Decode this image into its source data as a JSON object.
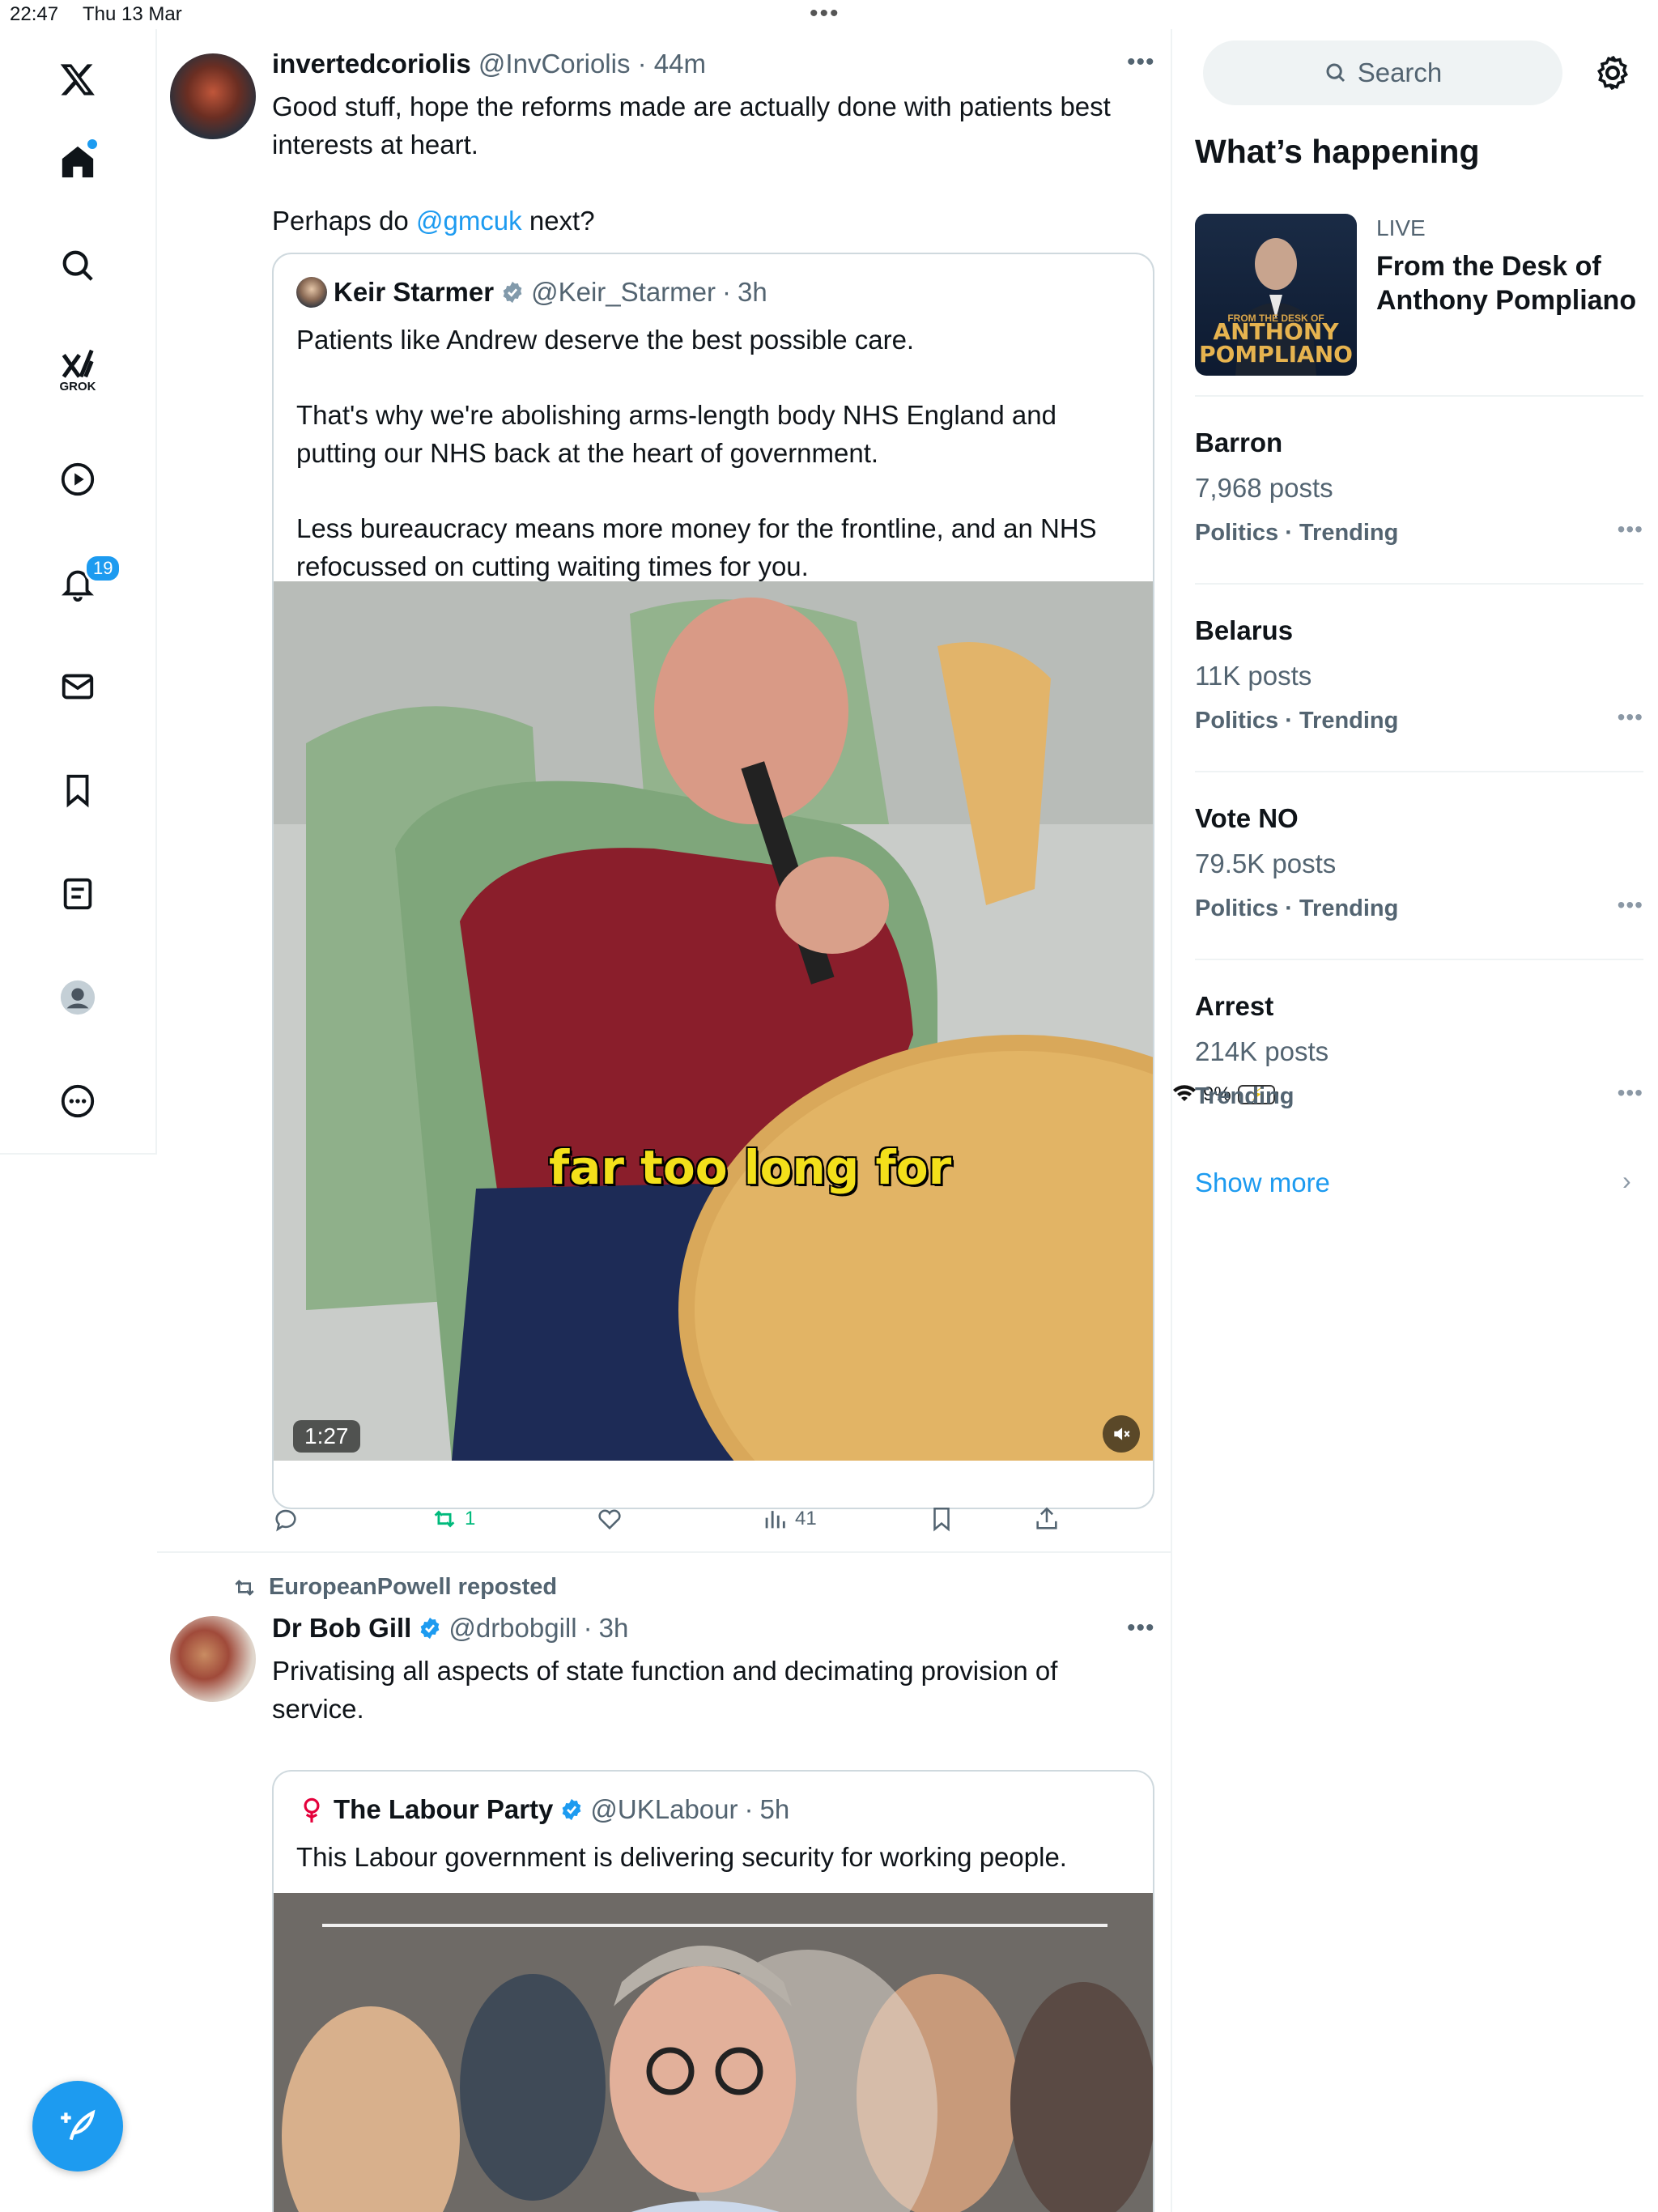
{
  "status_bar": {
    "time": "22:47",
    "date": "Thu 13 Mar",
    "battery": "9%"
  },
  "nav": {
    "grok_label": "GROK",
    "notifications_count": "19"
  },
  "tweets": [
    {
      "name": "invertedcoriolis",
      "handle": "@InvCoriolis",
      "time": "44m",
      "body_line1": "Good stuff, hope the reforms made are actually done with patients best",
      "body_line2": "interests at heart.",
      "body_line3_prefix": "Perhaps do ",
      "body_line3_link": "@gmcuk",
      "body_line3_suffix": " next?",
      "quote": {
        "name": "Keir Starmer",
        "handle": "@Keir_Starmer",
        "time": "3h",
        "p1": "Patients like Andrew deserve the best possible care.",
        "p2_line1": "That's why we're abolishing arms-length body NHS England and",
        "p2_line2": "putting our NHS back at the heart of government.",
        "p3_line1": "Less bureaucracy means more money for the frontline, and an NHS",
        "p3_line2": "refocussed on cutting waiting times for you.",
        "video_caption": "far too long for",
        "video_duration": "1:27"
      },
      "reposts": "1",
      "views": "41"
    },
    {
      "reposted_by": "EuropeanPowell reposted",
      "name": "Dr Bob Gill",
      "handle": "@drbobgill",
      "time": "3h",
      "body_line1": "Privatising all aspects of state function and decimating provision of",
      "body_line2": "service.",
      "quote": {
        "name": "The Labour Party",
        "handle": "@UKLabour",
        "time": "5h",
        "p1": "This Labour government is delivering security for working people."
      }
    }
  ],
  "sidebar": {
    "search_placeholder": "Search",
    "section_title": "What’s happening",
    "live": {
      "label": "LIVE",
      "title": "From the Desk of Anthony Pompliano",
      "thumb_small": "FROM THE DESK OF",
      "thumb_big1": "ANTHONY",
      "thumb_big2": "POMPLIANO"
    },
    "trends": [
      {
        "name": "Barron",
        "posts": "7,968 posts",
        "category": "Politics · Trending"
      },
      {
        "name": "Belarus",
        "posts": "11K posts",
        "category": "Politics · Trending"
      },
      {
        "name": "Vote NO",
        "posts": "79.5K posts",
        "category": "Politics · Trending"
      },
      {
        "name": "Arrest",
        "posts": "214K posts",
        "category": "Trending"
      }
    ],
    "show_more": "Show more"
  },
  "colors": {
    "accent": "#1d9bf0",
    "repost_green": "#00ba7c",
    "text_secondary": "#536471"
  }
}
